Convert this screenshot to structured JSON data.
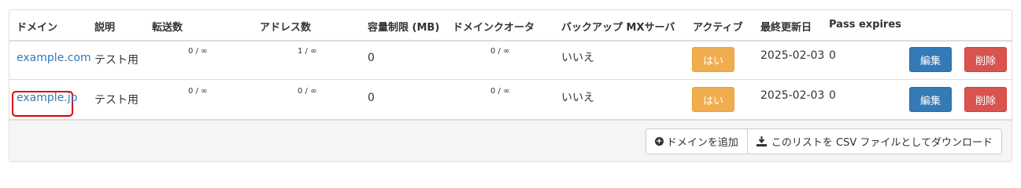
{
  "table": {
    "headers": {
      "domain": "ドメイン",
      "description": "説明",
      "forwards": "転送数",
      "addresses": "アドレス数",
      "quota": "容量制限 (MB)",
      "domain_quota": "ドメインクオータ",
      "backup_mx": "バックアップ MXサーバ",
      "active": "アクティブ",
      "last_modified": "最終更新日",
      "pass_expires": "Pass expires"
    },
    "rows": [
      {
        "domain": "example.com",
        "description": "テスト用",
        "forwards": "0 / ∞",
        "addresses": "1 / ∞",
        "quota": "0",
        "domain_quota": "0 / ∞",
        "backup_mx": "いいえ",
        "active_label": "はい",
        "last_modified": "2025-02-03",
        "pass_expires": "0",
        "edit_label": "編集",
        "delete_label": "削除"
      },
      {
        "domain": "example.jp",
        "description": "テスト用",
        "forwards": "0 / ∞",
        "addresses": "0 / ∞",
        "quota": "0",
        "domain_quota": "0 / ∞",
        "backup_mx": "いいえ",
        "active_label": "はい",
        "last_modified": "2025-02-03",
        "pass_expires": "0",
        "edit_label": "編集",
        "delete_label": "削除"
      }
    ]
  },
  "footer": {
    "add_domain_label": "ドメインを追加",
    "download_csv_label": "このリストを CSV ファイルとしてダウンロード"
  },
  "icons": {
    "add": "plus-circle-icon",
    "download": "download-icon"
  },
  "colors": {
    "link": "#337ab7",
    "warning": "#f0ad4e",
    "primary": "#337ab7",
    "danger": "#d9534f",
    "highlight": "#e00000"
  }
}
